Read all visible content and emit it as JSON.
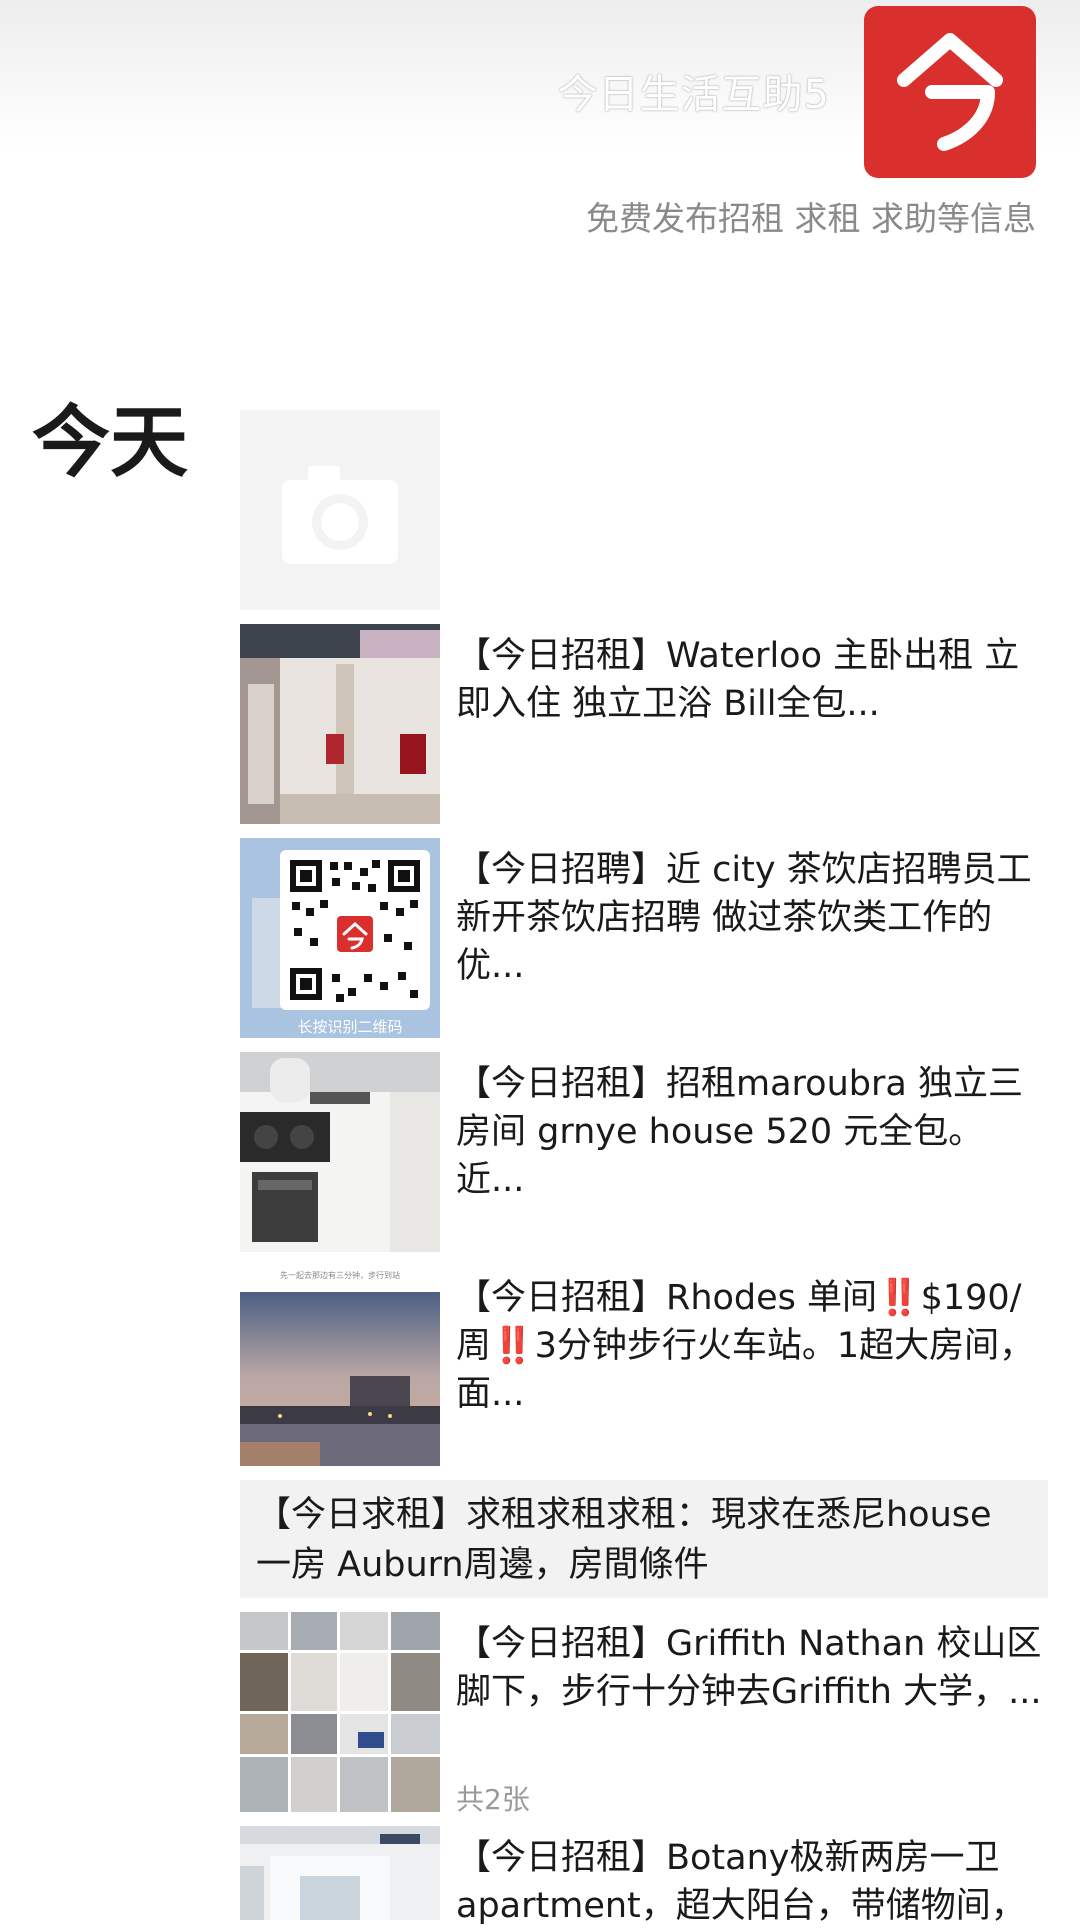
{
  "header": {
    "account_name": "今日生活互助5",
    "signature": "免费发布招租 求租 求助等信息",
    "avatar_icon": "jinri-logo-icon",
    "brand_color": "#d9302d"
  },
  "moments": {
    "day_label": "今天",
    "placeholder_icon": "camera-icon",
    "posts": [
      {
        "text": "【今日招租】Waterloo 主卧出租 立即入住 独立卫浴 Bill全包..."
      },
      {
        "text": "【今日招聘】近 city 茶饮店招聘员工 新开茶饮店招聘 做过茶饮类工作的优...",
        "qr_caption": "长按识别二维码"
      },
      {
        "text": "【今日招租】招租maroubra 独立三房间 grnye house 520 元全包。近..."
      },
      {
        "text_before": "【今日招租】Rhodes 单间",
        "text_mid": "$190/周",
        "text_after": "3分钟步行火车站。1超大房间，面...",
        "emoji": "‼️",
        "image_caption": "先一起去那边有三分钟，步行到站"
      },
      {
        "text": "【今日求租】求租求租求租：現求在悉尼house 一房 Auburn周邊，房間條件"
      },
      {
        "text": "【今日招租】Griffith Nathan 校山区脚下，步行十分钟去Griffith 大学，...",
        "count": "共2张"
      },
      {
        "text": "【今日招租】Botany极新两房一卫 apartment，超大阳台，带储物间，"
      }
    ]
  }
}
